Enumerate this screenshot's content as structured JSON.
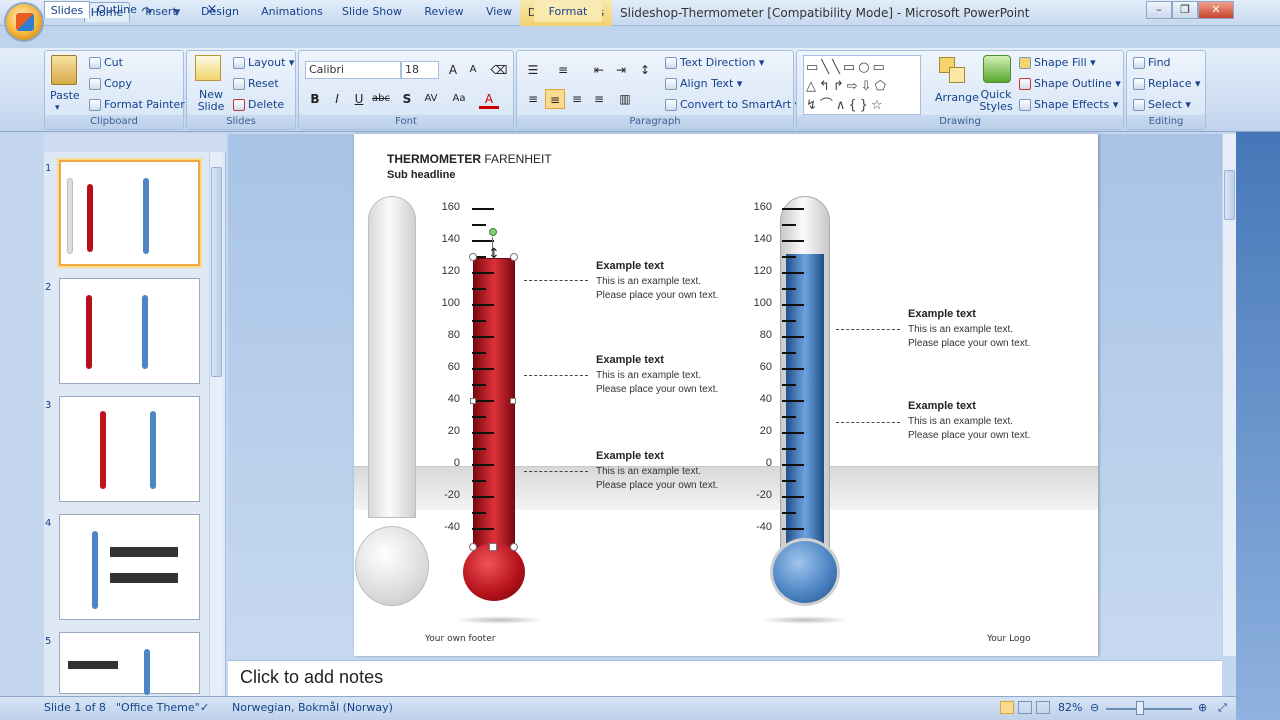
{
  "titlebar": {
    "context_tools": "Drawing Tools",
    "document_title": "Slideshop-Thermometer [Compatibility Mode] - Microsoft PowerPoint"
  },
  "tabs": [
    "Home",
    "Insert",
    "Design",
    "Animations",
    "Slide Show",
    "Review",
    "View",
    "Format"
  ],
  "ribbon": {
    "clipboard": {
      "paste": "Paste",
      "cut": "Cut",
      "copy": "Copy",
      "format_painter": "Format Painter",
      "label": "Clipboard"
    },
    "slides": {
      "new_slide": "New Slide",
      "layout": "Layout",
      "reset": "Reset",
      "delete": "Delete",
      "label": "Slides"
    },
    "font": {
      "family": "Calibri",
      "size": "18",
      "label": "Font"
    },
    "paragraph": {
      "text_direction": "Text Direction",
      "align_text": "Align Text",
      "convert_smartart": "Convert to SmartArt",
      "label": "Paragraph"
    },
    "drawing": {
      "arrange": "Arrange",
      "quick_styles": "Quick Styles",
      "shape_fill": "Shape Fill",
      "shape_outline": "Shape Outline",
      "shape_effects": "Shape Effects",
      "label": "Drawing"
    },
    "editing": {
      "find": "Find",
      "replace": "Replace",
      "select": "Select",
      "label": "Editing"
    }
  },
  "panel": {
    "tab_slides": "Slides",
    "tab_outline": "Outline",
    "close": "×",
    "thumb_numbers": [
      "1",
      "2",
      "3",
      "4",
      "5"
    ]
  },
  "slide": {
    "title_bold": "THERMOMETER",
    "title_rest": "FARENHEIT",
    "subtitle": "Sub headline",
    "scale": [
      "160",
      "140",
      "120",
      "100",
      "80",
      "60",
      "40",
      "20",
      "0",
      "-20",
      "-40"
    ],
    "left_thermometer": {
      "color": "#c0141d",
      "level": 135
    },
    "right_thermometer": {
      "color": "#4e86c4",
      "level": 135
    },
    "left_callouts": [
      {
        "title": "Example text",
        "line1": "This is an example text.",
        "line2": "Please place your own text."
      },
      {
        "title": "Example text",
        "line1": "This is an example text.",
        "line2": "Please place your own text."
      },
      {
        "title": "Example text",
        "line1": "This is an example text.",
        "line2": "Please place your own text."
      }
    ],
    "right_callouts": [
      {
        "title": "Example text",
        "line1": "This is an example text.",
        "line2": "Please place your own text."
      },
      {
        "title": "Example text",
        "line1": "This is an example text.",
        "line2": "Please place your own text."
      }
    ],
    "footer": "Your own footer",
    "logo": "Your Logo"
  },
  "notes": {
    "placeholder": "Click to add notes"
  },
  "status": {
    "slide_info": "Slide 1 of 8",
    "theme": "\"Office Theme\"",
    "language": "Norwegian, Bokmål (Norway)",
    "zoom": "82%"
  }
}
